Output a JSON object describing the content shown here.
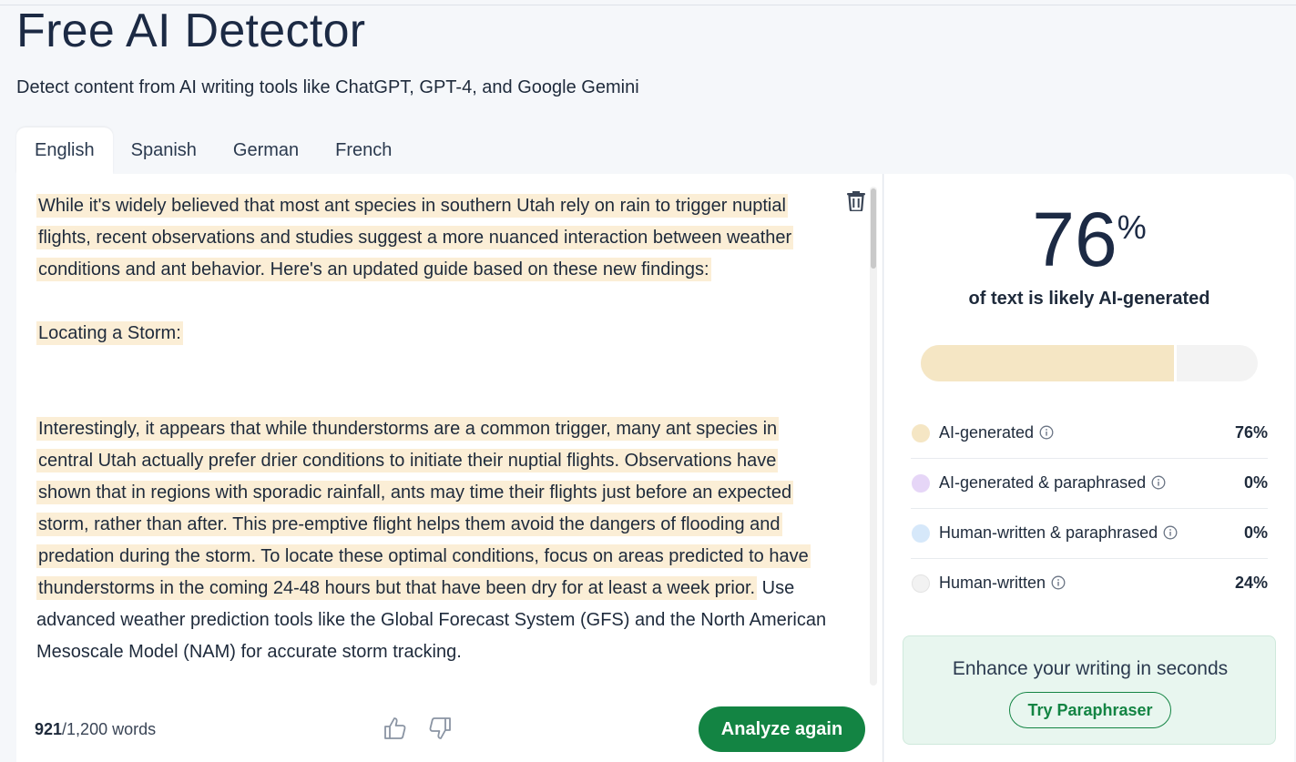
{
  "header": {
    "title": "Free AI Detector",
    "subtitle": "Detect content from AI writing tools like ChatGPT, GPT-4, and Google Gemini"
  },
  "tabs": [
    {
      "label": "English",
      "active": true
    },
    {
      "label": "Spanish",
      "active": false
    },
    {
      "label": "German",
      "active": false
    },
    {
      "label": "French",
      "active": false
    }
  ],
  "editor": {
    "paragraph1": "While it's widely believed that most ant species in southern Utah rely on rain to trigger nuptial flights, recent observations and studies suggest a more nuanced interaction between weather conditions and ant behavior. Here's an updated guide based on these new findings:",
    "heading": "Locating a Storm:",
    "paragraph2_highlighted": "Interestingly, it appears that while thunderstorms are a common trigger, many ant species in central Utah actually prefer drier conditions to initiate their nuptial flights. Observations have shown that in regions with sporadic rainfall, ants may time their flights just before an expected storm, rather than after. This pre-emptive flight helps them avoid the dangers of flooding and predation during the storm. To locate these optimal conditions, focus on areas predicted to have thunderstorms in the coming 24-48 hours but that have been dry for at least a week prior.",
    "paragraph2_plain": " Use advanced weather prediction tools like the Global Forecast System (GFS) and the North American Mesoscale Model (NAM) for accurate storm tracking.",
    "highlight_color": "#fbeed6"
  },
  "footer": {
    "word_count_current": "921",
    "word_count_total": "/1,200 words",
    "analyze_button": "Analyze again"
  },
  "results": {
    "score": "76",
    "score_unit": "%",
    "caption": "of text is likely AI-generated",
    "ai_fraction": 0.76,
    "legend": [
      {
        "label": "AI-generated",
        "value": "76%",
        "color": "#f5e6c4"
      },
      {
        "label": "AI-generated & paraphrased",
        "value": "0%",
        "color": "#e6d6f7"
      },
      {
        "label": "Human-written & paraphrased",
        "value": "0%",
        "color": "#d6e8fa"
      },
      {
        "label": "Human-written",
        "value": "24%",
        "color": "#f2f2f2"
      }
    ]
  },
  "promo": {
    "text": "Enhance your writing in seconds",
    "button": "Try Paraphraser"
  },
  "colors": {
    "accent_green": "#138443",
    "title_navy": "#1c2a44"
  }
}
